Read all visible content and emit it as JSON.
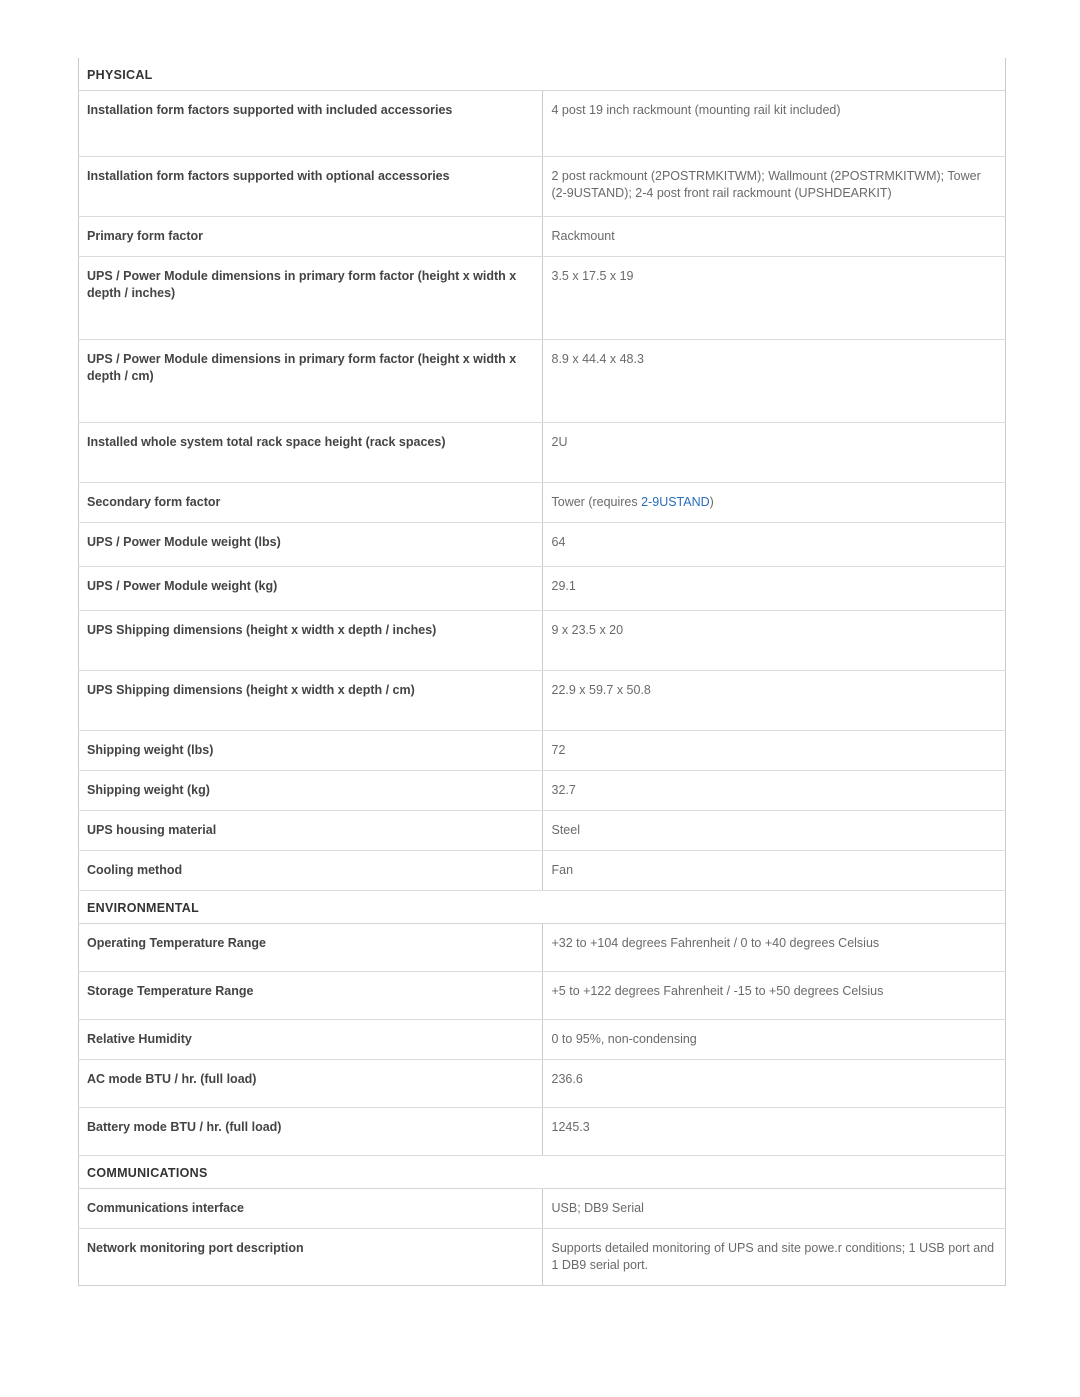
{
  "document": {
    "type": "product-specification-table",
    "link_color": "#2a6ebb",
    "label_color": "#444444",
    "value_color": "#6a6a6a",
    "header_color": "#333333"
  },
  "sections": [
    {
      "title": "PHYSICAL",
      "rows": [
        {
          "label": "Installation form factors supported with included accessories",
          "value": "4 post 19 inch rackmount (mounting rail kit included)"
        },
        {
          "label": "Installation form factors supported with optional accessories",
          "value": "2 post rackmount (2POSTRMKITWM); Wallmount (2POSTRMKITWM); Tower (2-9USTAND); 2-4 post front rail rackmount (UPSHDEARKIT)"
        },
        {
          "label": "Primary form factor",
          "value": "Rackmount"
        },
        {
          "label": "UPS / Power Module dimensions in primary form factor (height x width x depth / inches)",
          "value": "3.5 x 17.5 x 19"
        },
        {
          "label": "UPS / Power Module dimensions in primary form factor (height x width x depth / cm)",
          "value": "8.9 x 44.4 x 48.3"
        },
        {
          "label": "Installed whole system total rack space height (rack spaces)",
          "value": "2U"
        },
        {
          "label": "Secondary form factor",
          "value_prefix": "Tower (requires ",
          "value_link": "2-9USTAND",
          "value_suffix": ")"
        },
        {
          "label": "UPS / Power Module weight (lbs)",
          "value": "64"
        },
        {
          "label": "UPS / Power Module weight (kg)",
          "value": "29.1"
        },
        {
          "label": "UPS Shipping dimensions (height x width x depth / inches)",
          "value": "9 x 23.5 x 20"
        },
        {
          "label": "UPS Shipping dimensions (height x width x depth / cm)",
          "value": "22.9 x 59.7 x 50.8"
        },
        {
          "label": "Shipping weight (lbs)",
          "value": "72"
        },
        {
          "label": "Shipping weight (kg)",
          "value": "32.7"
        },
        {
          "label": "UPS housing material",
          "value": "Steel"
        },
        {
          "label": "Cooling method",
          "value": "Fan"
        }
      ]
    },
    {
      "title": "ENVIRONMENTAL",
      "rows": [
        {
          "label": "Operating Temperature Range",
          "value": "+32 to +104 degrees Fahrenheit / 0 to +40 degrees Celsius"
        },
        {
          "label": "Storage Temperature Range",
          "value": "+5 to +122 degrees Fahrenheit / -15 to +50 degrees Celsius"
        },
        {
          "label": "Relative Humidity",
          "value": "0 to 95%, non-condensing"
        },
        {
          "label": "AC mode BTU / hr. (full load)",
          "value": "236.6"
        },
        {
          "label": "Battery mode BTU / hr. (full load)",
          "value": "1245.3"
        }
      ]
    },
    {
      "title": "COMMUNICATIONS",
      "rows": [
        {
          "label": "Communications interface",
          "value": "USB; DB9 Serial"
        },
        {
          "label": "Network monitoring port description",
          "value": "Supports detailed monitoring of UPS and site powe.r conditions; 1 USB port and 1 DB9 serial port."
        }
      ]
    }
  ],
  "row_heights": {
    "r0": 66,
    "r1": 60,
    "r2": 34,
    "r3": 83,
    "r4": 83,
    "r5": 60,
    "r6": 34,
    "r7": 44,
    "r8": 44,
    "r9": 60,
    "r10": 60,
    "r11": 34,
    "r12": 34,
    "r13": 34,
    "r14": 34
  }
}
